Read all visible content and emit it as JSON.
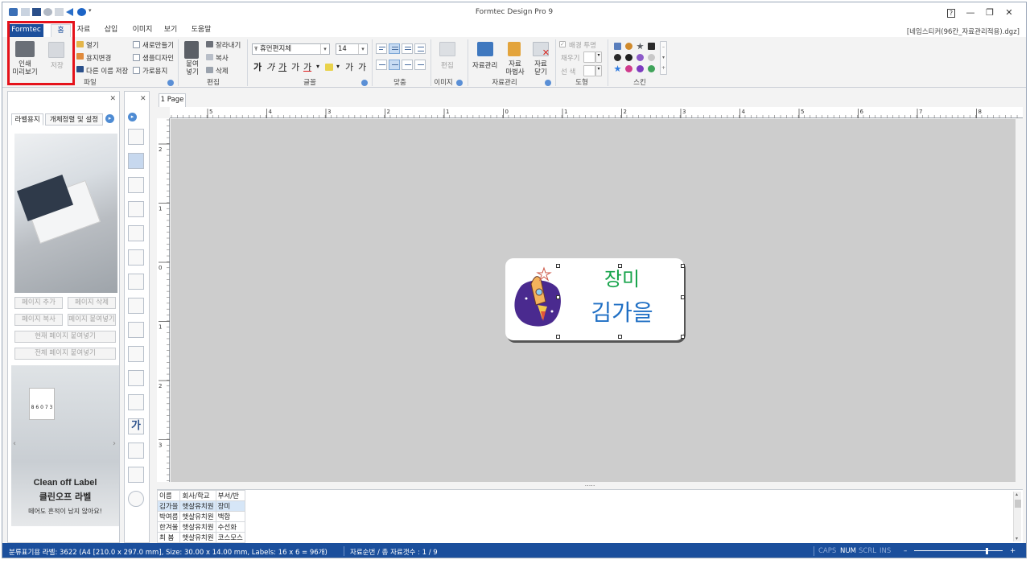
{
  "app": {
    "title": "Formtec Design Pro 9",
    "document": "[네임스티커(96칸_자료관리적용).dgz]"
  },
  "window_controls": {
    "help": "?",
    "minimize": "—",
    "restore": "❐",
    "close": "✕"
  },
  "tabs": [
    {
      "label": "Formtec"
    },
    {
      "label": "홈"
    },
    {
      "label": "자료"
    },
    {
      "label": "삽입"
    },
    {
      "label": "이미지"
    },
    {
      "label": "보기"
    },
    {
      "label": "도움말"
    }
  ],
  "ribbon": {
    "file_group": {
      "label": "파일",
      "print_preview": "인쇄\n미리보기",
      "save": "저장",
      "open": "열기",
      "change_paper": "용지변경",
      "save_as": "다른 이름 저장",
      "new": "새로만들기",
      "sample_design": "샘플디자인",
      "landscape": "가로용지"
    },
    "edit_group": {
      "label": "편집",
      "paste": "붙여\n넣기",
      "cut": "잘라내기",
      "copy": "복사",
      "delete": "삭제"
    },
    "font_group": {
      "label": "글꼴",
      "font_name": "휴먼편지체",
      "font_size": "14",
      "font_size_up": "가",
      "font_size_down": "가",
      "bold": "가",
      "italic": "가",
      "underline": "가",
      "strike": "가",
      "outline": "가",
      "shadow": "가"
    },
    "align_group": {
      "label": "맞춤"
    },
    "image_group": {
      "label": "이미지",
      "edit": "편집"
    },
    "data_group": {
      "label": "자료관리",
      "manage": "자료관리",
      "wizard": "자료\n마법사",
      "close": "자료\n닫기"
    },
    "shape_group": {
      "label": "도형",
      "bg_transparent": "배경 투명",
      "fill": "채우기",
      "line": "선 색"
    },
    "skin_group": {
      "label": "스킨"
    }
  },
  "left_panel": {
    "tabs": [
      "라벨용지",
      "개체정렬 및 설정"
    ],
    "buttons": {
      "add_page": "페이지 추가",
      "delete_page": "페이지 삭제",
      "copy_page": "페이지 복사",
      "paste_page": "페이지 붙여넣기",
      "paste_current": "현재 페이지 붙여넣기",
      "paste_all": "전체 페이지 붙여넣기"
    },
    "ad": {
      "brand_en": "Clean off Label",
      "brand_ko": "클린오프 라벨",
      "tagline": "떼어도 흔적이 남지 않아요!",
      "bottle_label": "8 6 0 7 3"
    }
  },
  "canvas": {
    "page_tab": "1 Page",
    "ruler_h_labels": [
      "5",
      "4",
      "3",
      "2",
      "1",
      "0",
      "1",
      "2",
      "3",
      "4",
      "5",
      "6",
      "7",
      "8"
    ],
    "ruler_v_labels": [
      "2",
      "1",
      "0",
      "1",
      "2",
      "3"
    ],
    "label": {
      "line1": "장미",
      "line2": "김가을"
    },
    "splitter": "....."
  },
  "grid": {
    "headers": [
      "이름",
      "회사/학교",
      "부서/반"
    ],
    "rows": [
      [
        "김가을",
        "햇살유치원",
        "장미"
      ],
      [
        "박여름",
        "햇살유치원",
        "백합"
      ],
      [
        "한겨울",
        "햇살유치원",
        "수선화"
      ],
      [
        "최  봄",
        "햇살유치원",
        "코스모스"
      ]
    ]
  },
  "status": {
    "label_info": "분류표기용 라벨: 3622 (A4 [210.0 x 297.0 mm], Size: 30.00 x 14.00 mm,  Labels: 16 x 6 = 96개)",
    "record_info": "자료순번 / 총 자료갯수 : 1 / 9",
    "caps": "CAPS",
    "num": "NUM",
    "scrl": "SCRL",
    "ins": "INS",
    "zoom_minus": "–",
    "zoom_plus": "+"
  },
  "colors": {
    "accent": "#1b4f9c",
    "highlight": "#e5121b",
    "label_green": "#16a34a",
    "label_blue": "#1f6fc4"
  }
}
